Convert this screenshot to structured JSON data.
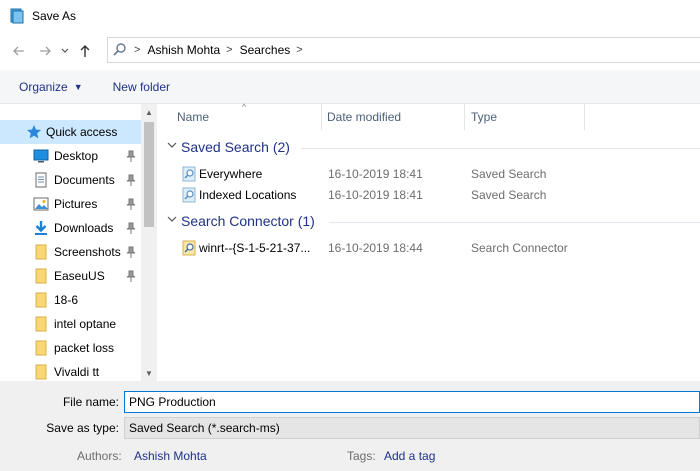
{
  "window": {
    "title": "Save As"
  },
  "address": {
    "breadcrumbs": [
      "Ashish Mohta",
      "Searches"
    ],
    "separator": ">"
  },
  "toolbar": {
    "organize_label": "Organize",
    "new_folder_label": "New folder"
  },
  "nav": {
    "items": [
      {
        "label": "Quick access",
        "icon": "star-icon",
        "pinned": false,
        "selected": true
      },
      {
        "label": "Desktop",
        "icon": "desktop-icon",
        "pinned": true
      },
      {
        "label": "Documents",
        "icon": "documents-icon",
        "pinned": true
      },
      {
        "label": "Pictures",
        "icon": "pictures-icon",
        "pinned": true
      },
      {
        "label": "Downloads",
        "icon": "downloads-icon",
        "pinned": true
      },
      {
        "label": "Screenshots",
        "icon": "folder-icon",
        "pinned": true
      },
      {
        "label": "EaseuUS",
        "icon": "folder-icon",
        "pinned": true
      },
      {
        "label": "18-6",
        "icon": "folder-icon",
        "pinned": false
      },
      {
        "label": "intel optane",
        "icon": "folder-icon",
        "pinned": false
      },
      {
        "label": "packet loss",
        "icon": "folder-icon",
        "pinned": false
      },
      {
        "label": "Vivaldi tt",
        "icon": "folder-icon",
        "pinned": false
      }
    ]
  },
  "columns": {
    "name": "Name",
    "date_modified": "Date modified",
    "type": "Type"
  },
  "groups": [
    {
      "header": "Saved Search (2)",
      "rows": [
        {
          "name": "Everywhere",
          "date": "16-10-2019 18:41",
          "type": "Saved Search",
          "icon": "saved-search-icon"
        },
        {
          "name": "Indexed Locations",
          "date": "16-10-2019 18:41",
          "type": "Saved Search",
          "icon": "saved-search-icon"
        }
      ]
    },
    {
      "header": "Search Connector (1)",
      "rows": [
        {
          "name": "winrt--{S-1-5-21-37...",
          "date": "16-10-2019 18:44",
          "type": "Search Connector",
          "icon": "search-connector-icon"
        }
      ]
    }
  ],
  "form": {
    "file_name_label": "File name:",
    "file_name_value": "PNG Production",
    "save_as_type_label": "Save as type:",
    "save_as_type_value": "Saved Search (*.search-ms)",
    "authors_label": "Authors:",
    "authors_value": "Ashish Mohta",
    "tags_label": "Tags:",
    "tags_value": "Add a tag"
  },
  "colors": {
    "accent": "#0078d7",
    "link": "#1e3287",
    "selected_bg": "#cce8ff",
    "folder": "#f8d775"
  }
}
